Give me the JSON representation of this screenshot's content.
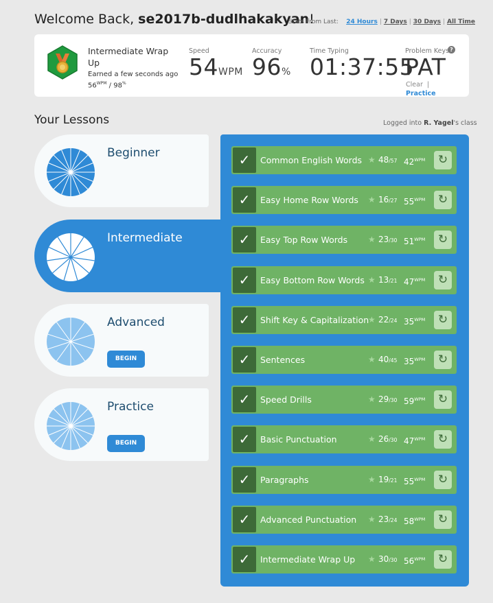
{
  "header": {
    "welcome_prefix": "Welcome Back, ",
    "username": "se2017b-dudlhakakyan",
    "welcome_suffix": "!",
    "stats_from_label": "Stats From Last:",
    "ranges": [
      "24 Hours",
      "7 Days",
      "30 Days",
      "All Time"
    ],
    "active_range": "24 Hours"
  },
  "achievement": {
    "title": "Intermediate Wrap Up",
    "earned": "Earned a few seconds ago",
    "wpm_value": "56",
    "wpm_unit": "WPM",
    "accuracy_value": "98",
    "accuracy_unit": "%",
    "separator": " / ",
    "icon": "medal-icon",
    "colors": {
      "hex": "#1f9a3e",
      "medal": "#e8b23a",
      "ribbon": "#d9682a"
    }
  },
  "stats": {
    "speed_label": "Speed",
    "speed_value": "54",
    "speed_unit": "WPM",
    "accuracy_label": "Accuracy",
    "accuracy_value": "96",
    "accuracy_unit": "%",
    "time_label": "Time Typing",
    "time_value": "01:37:55",
    "problem_label": "Problem Keys",
    "problem_value": "PAT",
    "clear_label": "Clear",
    "clear_sep": "|",
    "practice_label": "Practice"
  },
  "lessons_section": {
    "title": "Your Lessons",
    "logged_prefix": "Logged into ",
    "teacher": "R. Yagel",
    "logged_suffix": "'s class"
  },
  "categories": [
    {
      "name": "Beginner",
      "state": "complete",
      "button": ""
    },
    {
      "name": "Intermediate",
      "state": "active",
      "button": ""
    },
    {
      "name": "Advanced",
      "state": "locked",
      "button": "BEGIN"
    },
    {
      "name": "Practice",
      "state": "locked",
      "button": "BEGIN"
    }
  ],
  "lessons": [
    {
      "title": "Common English Words",
      "stars": "48",
      "max": "/57",
      "wpm": "42",
      "unit": "WPM"
    },
    {
      "title": "Easy Home Row Words",
      "stars": "16",
      "max": "/27",
      "wpm": "55",
      "unit": "WPM"
    },
    {
      "title": "Easy Top Row Words",
      "stars": "23",
      "max": "/30",
      "wpm": "51",
      "unit": "WPM"
    },
    {
      "title": "Easy Bottom Row Words",
      "stars": "13",
      "max": "/21",
      "wpm": "47",
      "unit": "WPM"
    },
    {
      "title": "Shift Key & Capitalization",
      "stars": "22",
      "max": "/24",
      "wpm": "35",
      "unit": "WPM"
    },
    {
      "title": "Sentences",
      "stars": "40",
      "max": "/45",
      "wpm": "35",
      "unit": "WPM"
    },
    {
      "title": "Speed Drills",
      "stars": "29",
      "max": "/30",
      "wpm": "59",
      "unit": "WPM"
    },
    {
      "title": "Basic Punctuation",
      "stars": "26",
      "max": "/30",
      "wpm": "47",
      "unit": "WPM"
    },
    {
      "title": "Paragraphs",
      "stars": "19",
      "max": "/21",
      "wpm": "55",
      "unit": "WPM"
    },
    {
      "title": "Advanced Punctuation",
      "stars": "23",
      "max": "/24",
      "wpm": "58",
      "unit": "WPM"
    },
    {
      "title": "Intermediate Wrap Up",
      "stars": "30",
      "max": "/30",
      "wpm": "56",
      "unit": "WPM"
    }
  ],
  "colors": {
    "accent": "#2f8ad6",
    "lesson_green": "#6fb365",
    "check_dark": "#3d6a38"
  }
}
